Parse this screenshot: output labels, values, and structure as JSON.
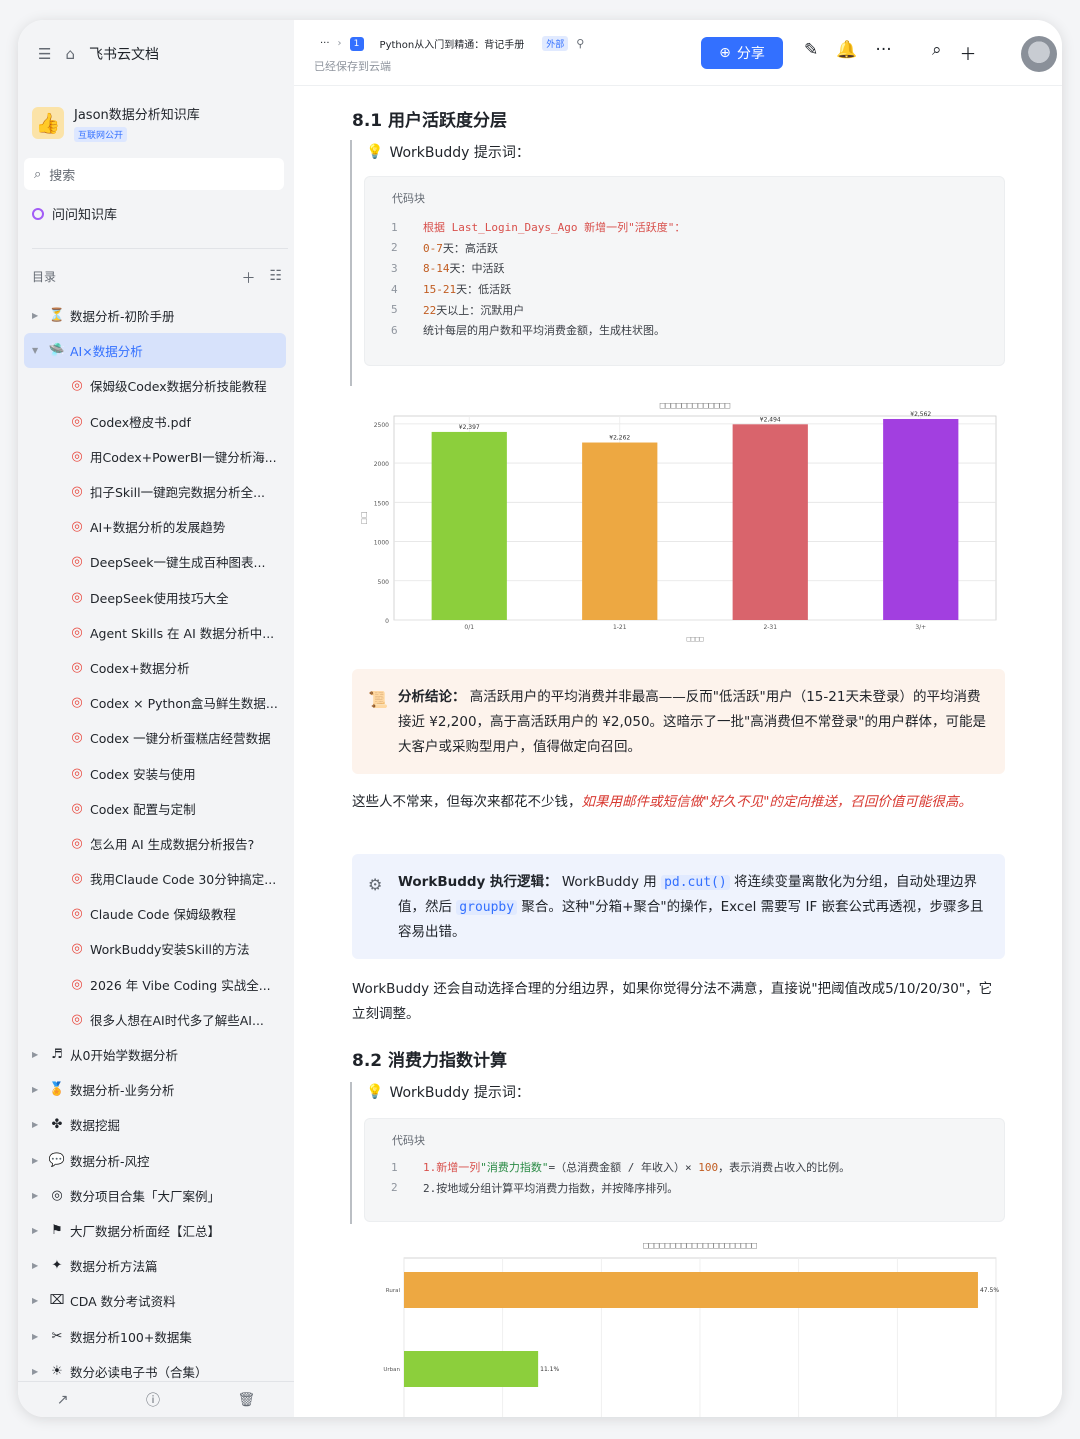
{
  "sidebar": {
    "app_title": "飞书云文档",
    "kb_name": "Jason数据分析知识库",
    "kb_tag": "互联网公开",
    "search_placeholder": "搜索",
    "ask_label": "问问知识库",
    "toc_title": "目录",
    "toc": [
      {
        "label": "数据分析-初阶手册",
        "icon": "⏳",
        "level": 0,
        "expanded": false
      },
      {
        "label": "AI×数据分析",
        "icon": "🛸",
        "level": 0,
        "expanded": true,
        "active": true
      },
      {
        "label": "保姆级Codex数据分析技能教程",
        "icon": "◎",
        "level": 1
      },
      {
        "label": "Codex橙皮书.pdf",
        "icon": "◎",
        "level": 1
      },
      {
        "label": "用Codex+PowerBI一键分析海...",
        "icon": "◎",
        "level": 1
      },
      {
        "label": "扣子Skill一键跑完数据分析全...",
        "icon": "◎",
        "level": 1
      },
      {
        "label": "AI+数据分析的发展趋势",
        "icon": "◎",
        "level": 1
      },
      {
        "label": "DeepSeek一键生成百种图表...",
        "icon": "◎",
        "level": 1
      },
      {
        "label": "DeepSeek使用技巧大全",
        "icon": "◎",
        "level": 1
      },
      {
        "label": "Agent Skills 在 AI 数据分析中...",
        "icon": "◎",
        "level": 1
      },
      {
        "label": "Codex+数据分析",
        "icon": "◎",
        "level": 1
      },
      {
        "label": "Codex × Python盒马鲜生数据...",
        "icon": "◎",
        "level": 1
      },
      {
        "label": "Codex 一键分析蛋糕店经营数据",
        "icon": "◎",
        "level": 1
      },
      {
        "label": "Codex 安装与使用",
        "icon": "◎",
        "level": 1
      },
      {
        "label": "Codex 配置与定制",
        "icon": "◎",
        "level": 1
      },
      {
        "label": "怎么用 AI 生成数据分析报告?",
        "icon": "◎",
        "level": 1
      },
      {
        "label": "我用Claude Code 30分钟搞定...",
        "icon": "◎",
        "level": 1
      },
      {
        "label": "Claude Code 保姆级教程",
        "icon": "◎",
        "level": 1
      },
      {
        "label": "WorkBuddy安装Skill的方法",
        "icon": "◎",
        "level": 1
      },
      {
        "label": "2026 年 Vibe Coding 实战全...",
        "icon": "◎",
        "level": 1
      },
      {
        "label": "很多人想在AI时代多了解些AI...",
        "icon": "◎",
        "level": 1
      },
      {
        "label": "从0开始学数据分析",
        "icon": "♬",
        "level": 0,
        "expanded": false
      },
      {
        "label": "数据分析-业务分析",
        "icon": "🏅",
        "level": 0,
        "expanded": false
      },
      {
        "label": "数据挖掘",
        "icon": "✤",
        "level": 0,
        "expanded": false
      },
      {
        "label": "数据分析-风控",
        "icon": "💬",
        "level": 0,
        "expanded": false
      },
      {
        "label": "数分项目合集「大厂案例」",
        "icon": "◎",
        "level": 0,
        "expanded": false
      },
      {
        "label": "大厂数据分析面经【汇总】",
        "icon": "⚑",
        "level": 0,
        "expanded": false
      },
      {
        "label": "数据分析方法篇",
        "icon": "✦",
        "level": 0,
        "expanded": false
      },
      {
        "label": "CDA 数分考试资料",
        "icon": "⌧",
        "level": 0,
        "expanded": false
      },
      {
        "label": "数据分析100+数据集",
        "icon": "✂",
        "level": 0,
        "expanded": false
      },
      {
        "label": "数分必读电子书（合集）",
        "icon": "☀",
        "level": 0,
        "expanded": false
      }
    ]
  },
  "header": {
    "breadcrumb_more": "···",
    "doc_title": "Python从入门到精通：背记手册",
    "doc_tag": "外部",
    "doc_badge": "1",
    "saved_text": "已经保存到云端",
    "share_label": "分享"
  },
  "doc": {
    "s1_title": "8.1 用户活跃度分层",
    "prompt_label": "WorkBuddy 提示词：",
    "code_label": "代码块",
    "code1": [
      {
        "n": "1",
        "parts": [
          [
            "根据 Last_Login_Days_Ago 新增一列\"活跃度\"：",
            "c-red"
          ]
        ]
      },
      {
        "n": "2",
        "parts": [
          [
            "0-7",
            "c-org"
          ],
          [
            "天：高活跃",
            "c-dark"
          ]
        ]
      },
      {
        "n": "3",
        "parts": [
          [
            "8-14",
            "c-org"
          ],
          [
            "天：中活跃",
            "c-dark"
          ]
        ]
      },
      {
        "n": "4",
        "parts": [
          [
            "15-21",
            "c-org"
          ],
          [
            "天：低活跃",
            "c-dark"
          ]
        ]
      },
      {
        "n": "5",
        "parts": [
          [
            "22",
            "c-org"
          ],
          [
            "天以上：沉默用户",
            "c-dark"
          ]
        ]
      },
      {
        "n": "6",
        "parts": [
          [
            "统计每层的用户数和平均消费金额，生成柱状图。",
            "c-dark"
          ]
        ]
      }
    ],
    "callout1_label": "分析结论：",
    "callout1_text": "高活跃用户的平均消费并非最高——反而\"低活跃\"用户（15-21天未登录）的平均消费接近 ¥2,200，高于高活跃用户的 ¥2,050。这暗示了一批\"高消费但不常登录\"的用户群体，可能是大客户或采购型用户，值得做定向召回。",
    "para1_plain": "这些人不常来，但每次来都花不少钱，",
    "para1_red": "如果用邮件或短信做\"好久不见\"的定向推送，召回价值可能很高。",
    "callout2_label": "WorkBuddy 执行逻辑：",
    "callout2_a": "WorkBuddy 用 ",
    "callout2_code1": "pd.cut()",
    "callout2_b": " 将连续变量离散化为分组，自动处理边界值，然后 ",
    "callout2_code2": "groupby",
    "callout2_c": " 聚合。这种\"分箱+聚合\"的操作，Excel 需要写 IF 嵌套公式再透视，步骤多且容易出错。",
    "para2": "WorkBuddy 还会自动选择合理的分组边界，如果你觉得分法不满意，直接说\"把阈值改成5/10/20/30\"，它立刻调整。",
    "s2_title": "8.2 消费力指数计算",
    "code2": [
      {
        "n": "1",
        "parts": [
          [
            "1.新增一列",
            "c-red"
          ],
          [
            "\"消费力指数\"",
            "c-grn"
          ],
          [
            "=（总消费金额 / 年收入）× ",
            "c-dark"
          ],
          [
            "100",
            "c-org"
          ],
          [
            "，表示消费占收入的比例。",
            "c-dark"
          ]
        ]
      },
      {
        "n": "2",
        "parts": [
          [
            "2.按地域分组计算平均消费力指数，并按降序排列。",
            "c-dark"
          ]
        ]
      }
    ]
  },
  "chart_data": [
    {
      "type": "bar",
      "title": "□□□□□□□□□□□□□",
      "xlabel": "□□□□",
      "ylabel": "□□",
      "categories": [
        "0-7",
        "8-14",
        "15-21",
        "22+"
      ],
      "category_labels": [
        "0/1",
        "1-21",
        "2-31",
        "3/+"
      ],
      "values": [
        2397,
        2262,
        2494,
        2562
      ],
      "value_labels": [
        "¥2,397",
        "¥2,262",
        "¥2,494",
        "¥2,562"
      ],
      "colors": [
        "#8ccf3c",
        "#eda842",
        "#d9646c",
        "#a23fe0"
      ],
      "ylim": [
        0,
        2600
      ],
      "yticks": [
        0,
        500,
        1000,
        1500,
        2000,
        2500
      ],
      "grid": true
    },
    {
      "type": "bar",
      "orientation": "horizontal",
      "title": "□□□□□□□□□□□□□□□□□□□□□",
      "categories": [
        "Rural",
        "Urban"
      ],
      "values": [
        47.5,
        11.1
      ],
      "value_labels": [
        "47.5%",
        "11.1%"
      ],
      "colors": [
        "#eda842",
        "#8ccf3c"
      ],
      "xlim": [
        0,
        48
      ],
      "grid": true
    }
  ],
  "colors": {
    "accent": "#3370ff",
    "callout_warm": "#fdf3ec",
    "callout_blue": "#eff3fd"
  }
}
